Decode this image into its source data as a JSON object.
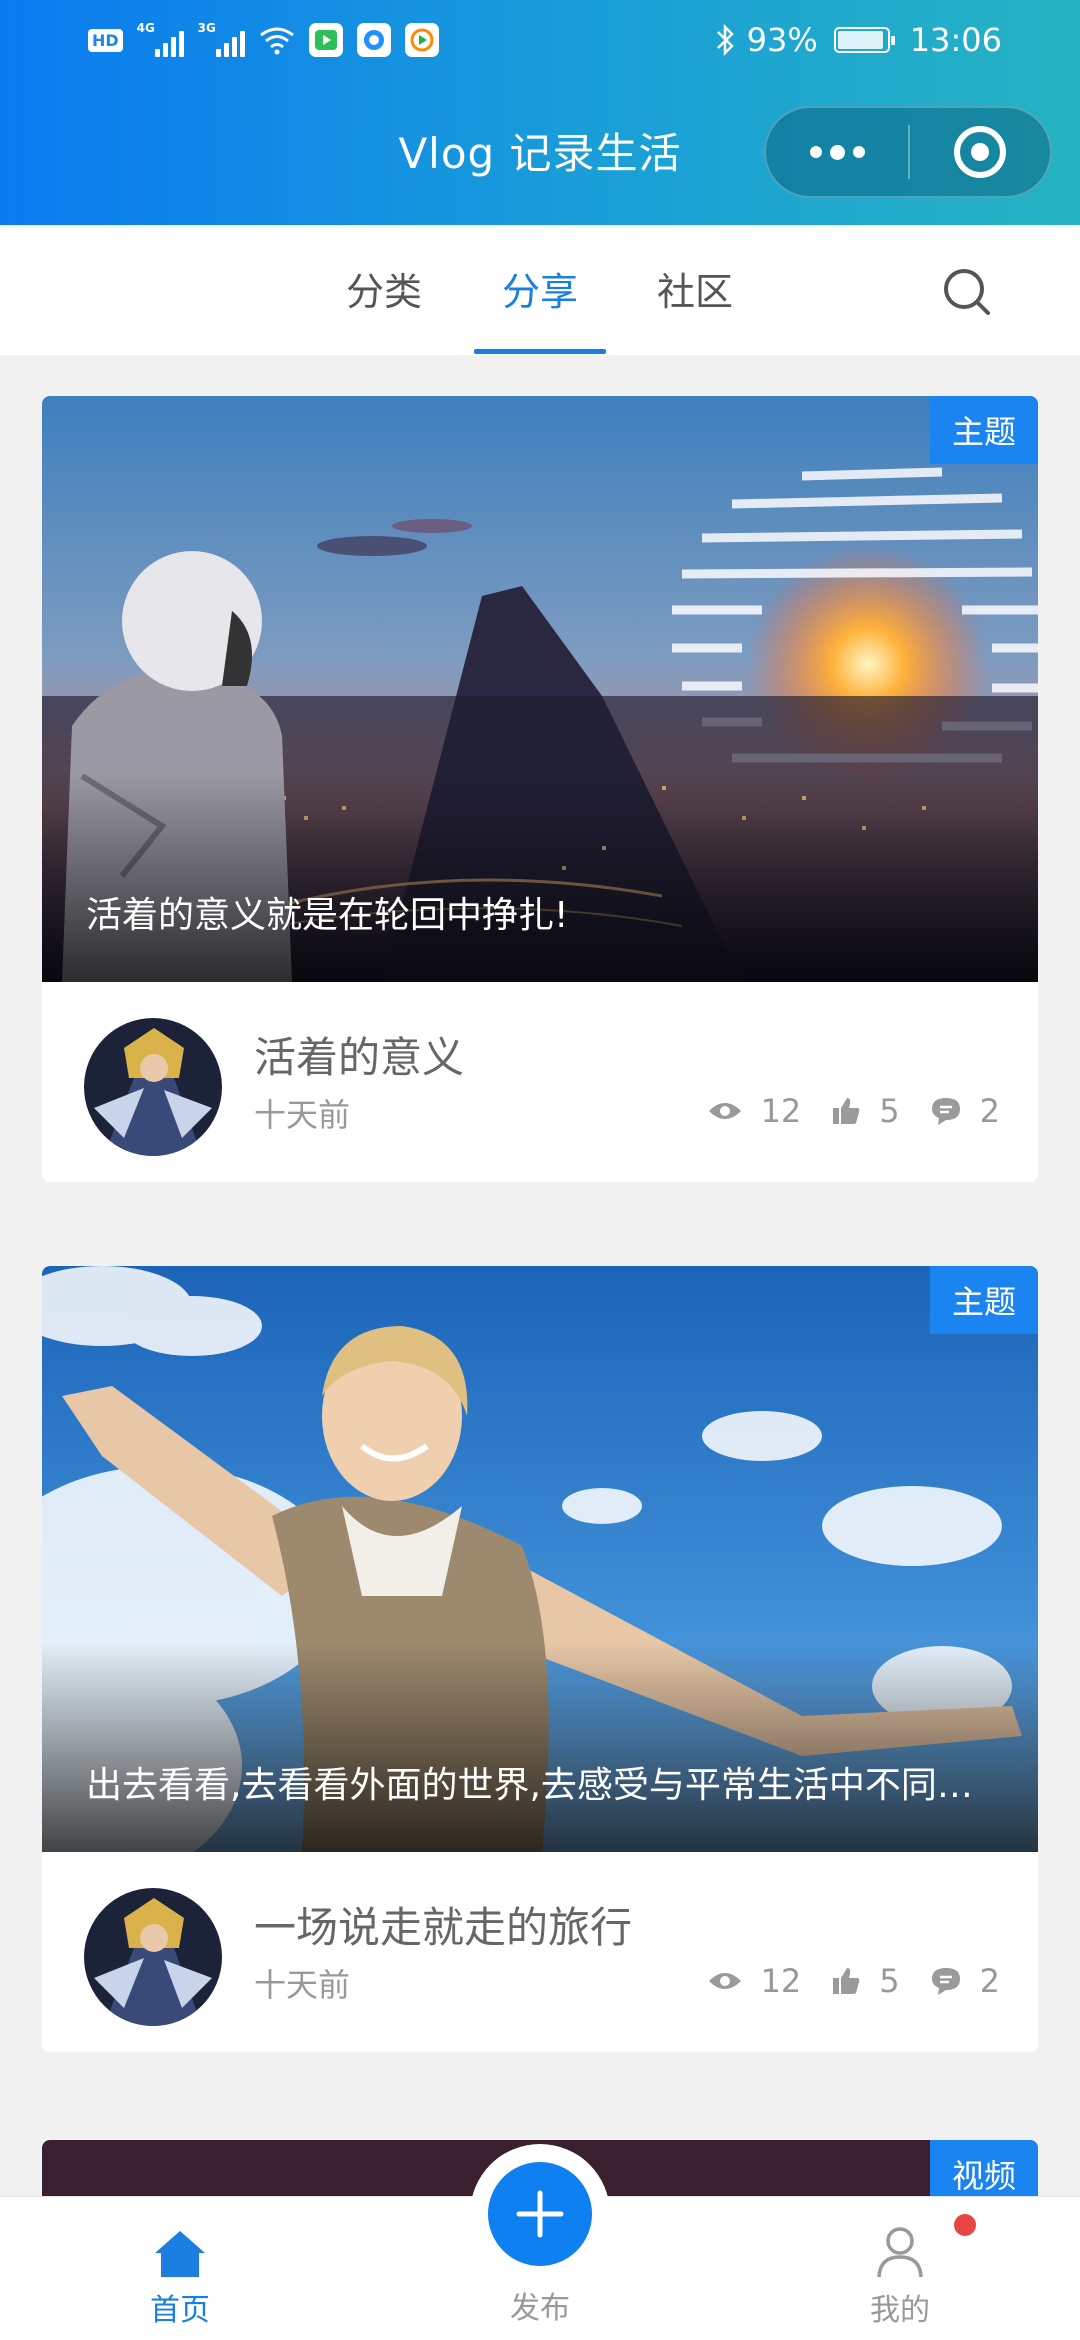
{
  "status_bar": {
    "signal_labels": [
      "4G",
      "3G"
    ],
    "battery": "93%",
    "time": "13:06",
    "hd_label": "HD"
  },
  "header": {
    "title": "Vlog 记录生活"
  },
  "tabs": [
    {
      "label": "分类"
    },
    {
      "label": "分享"
    },
    {
      "label": "社区"
    }
  ],
  "active_tab": "分享",
  "posts": [
    {
      "badge": "主题",
      "caption": "活着的意义就是在轮回中挣扎!",
      "title": "活着的意义",
      "time": "十天前",
      "views": "12",
      "likes": "5",
      "comments": "2"
    },
    {
      "badge": "主题",
      "caption": "出去看看,去看看外面的世界,去感受与平常生活中不同的风景",
      "title": "一场说走就走的旅行",
      "time": "十天前",
      "views": "12",
      "likes": "5",
      "comments": "2"
    },
    {
      "badge": "视频"
    }
  ],
  "bottom_nav": [
    {
      "label": "首页"
    },
    {
      "label": "发布"
    },
    {
      "label": "我的"
    }
  ],
  "colors": {
    "accent": "#1a7fe0",
    "header_start": "#0a7af0",
    "header_end": "#25b3c2",
    "badge": "#1a84f0",
    "notification_dot": "#e84545"
  }
}
